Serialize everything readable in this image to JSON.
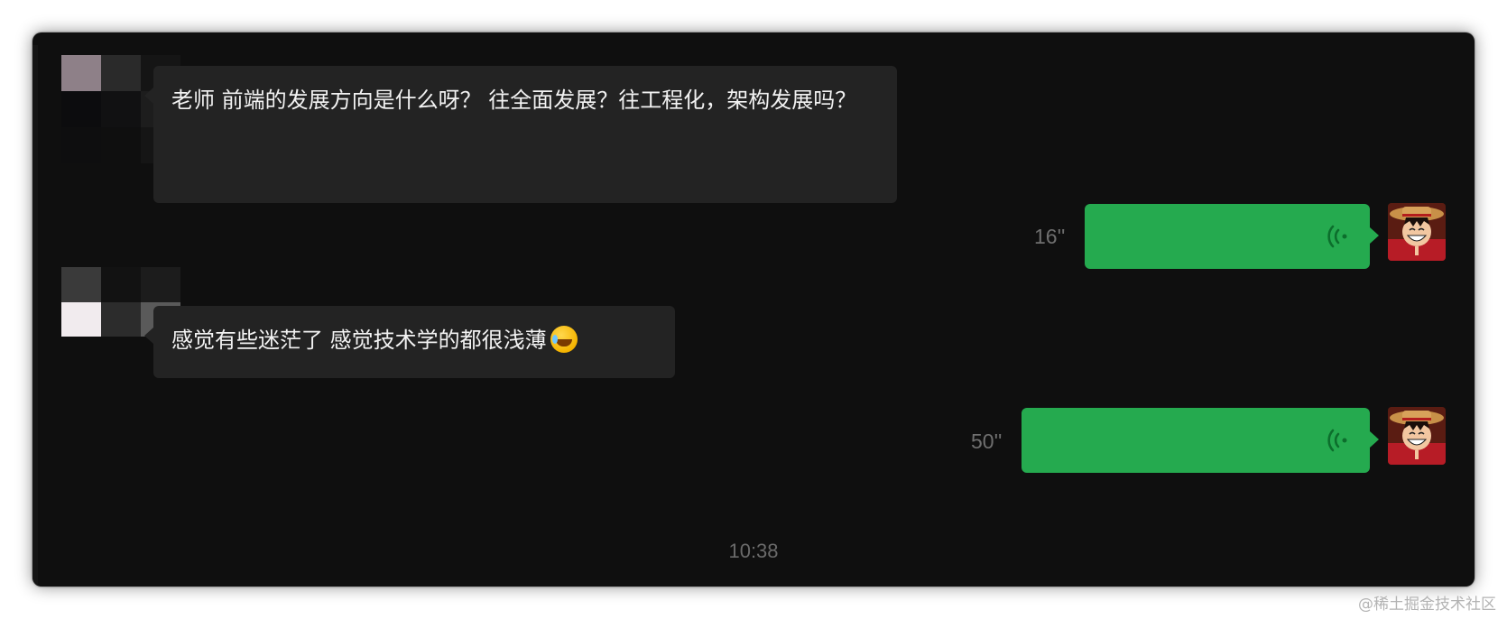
{
  "messages": {
    "incoming_1": "老师 前端的发展方向是什么呀？ 往全面发展？往工程化，架构发展吗？",
    "incoming_2": "感觉有些迷茫了 感觉技术学的都很浅薄",
    "voice_1_duration": "16''",
    "voice_2_duration": "50''"
  },
  "timestamp": "10:38",
  "watermark": "@稀土掘金技术社区",
  "icons": {
    "voice": "sound-wave-icon",
    "emoji": "laughing-tears-emoji-icon",
    "avatar_sender": "pixelated-avatar",
    "avatar_self": "anime-avatar"
  },
  "colors": {
    "window_bg": "#0f0f0f",
    "incoming_bubble": "#232323",
    "outgoing_bubble": "#25aa4f",
    "muted_text": "#6f6f6f"
  }
}
